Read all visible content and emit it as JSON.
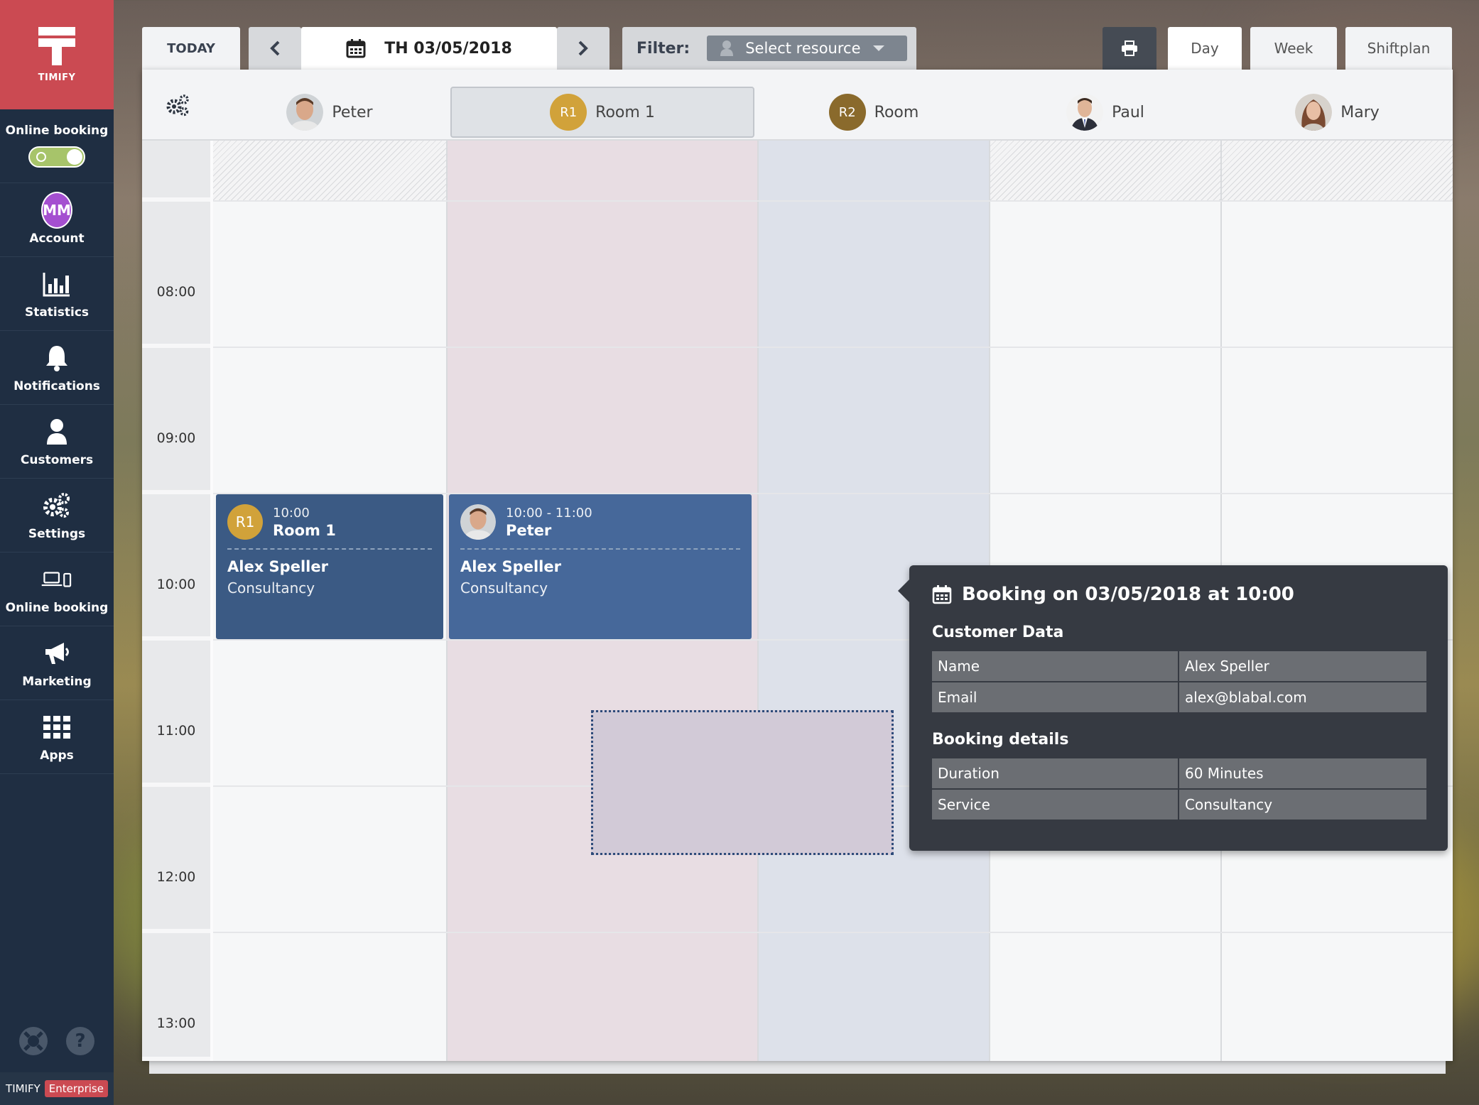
{
  "sidebar": {
    "logo_text": "TIMIFY",
    "online_booking_toggle": {
      "label": "Online booking",
      "state": "on"
    },
    "items": [
      {
        "label": "Account",
        "icon": "mm-avatar",
        "avatar_initials": "MM"
      },
      {
        "label": "Statistics",
        "icon": "bar-chart-icon"
      },
      {
        "label": "Notifications",
        "icon": "bell-icon"
      },
      {
        "label": "Customers",
        "icon": "user-icon"
      },
      {
        "label": "Settings",
        "icon": "gears-icon"
      },
      {
        "label": "Online booking",
        "icon": "devices-icon"
      },
      {
        "label": "Marketing",
        "icon": "megaphone-icon"
      },
      {
        "label": "Apps",
        "icon": "grid-icon"
      }
    ],
    "footer_icons": [
      "lifebuoy-icon",
      "help-icon"
    ],
    "help_glyph": "?",
    "brand": {
      "name": "TIMIFY",
      "badge": "Enterprise"
    }
  },
  "toolbar": {
    "today_label": "TODAY",
    "date_label": "TH 03/05/2018",
    "filter_label": "Filter:",
    "resource_placeholder": "Select resource",
    "views": [
      {
        "label": "Day",
        "active": true
      },
      {
        "label": "Week",
        "active": false
      },
      {
        "label": "Shiftplan",
        "active": false
      }
    ]
  },
  "calendar": {
    "resources": [
      {
        "name": "Peter",
        "type": "person"
      },
      {
        "name": "Room 1",
        "type": "room",
        "badge": "R1",
        "badge_color": "#d1a23a",
        "selected": true
      },
      {
        "name": "Room",
        "type": "room",
        "badge": "R2",
        "badge_color": "#8a6a2c"
      },
      {
        "name": "Paul",
        "type": "person"
      },
      {
        "name": "Mary",
        "type": "person"
      }
    ],
    "times": [
      "08:00",
      "09:00",
      "10:00",
      "11:00",
      "12:00",
      "13:00"
    ],
    "events": [
      {
        "badge": "R1",
        "time": "10:00",
        "title": "Room 1",
        "customer": "Alex Speller",
        "service": "Consultancy"
      },
      {
        "time": "10:00 - 11:00",
        "title": "Peter",
        "customer": "Alex Speller",
        "service": "Consultancy"
      }
    ]
  },
  "tooltip": {
    "title": "Booking on 03/05/2018 at 10:00",
    "customer_section": "Customer Data",
    "customer_rows": [
      {
        "key": "Name",
        "value": "Alex Speller"
      },
      {
        "key": "Email",
        "value": "alex@blabal.com"
      }
    ],
    "booking_section": "Booking details",
    "booking_rows": [
      {
        "key": "Duration",
        "value": "60 Minutes"
      },
      {
        "key": "Service",
        "value": "Consultancy"
      }
    ]
  },
  "colors": {
    "brand_red": "#cb4a52",
    "sidebar_bg": "#1f2e42",
    "event_blue": "#3e5f8c",
    "room1_column": "#e8dde3",
    "room2_column": "#dde1ea"
  }
}
